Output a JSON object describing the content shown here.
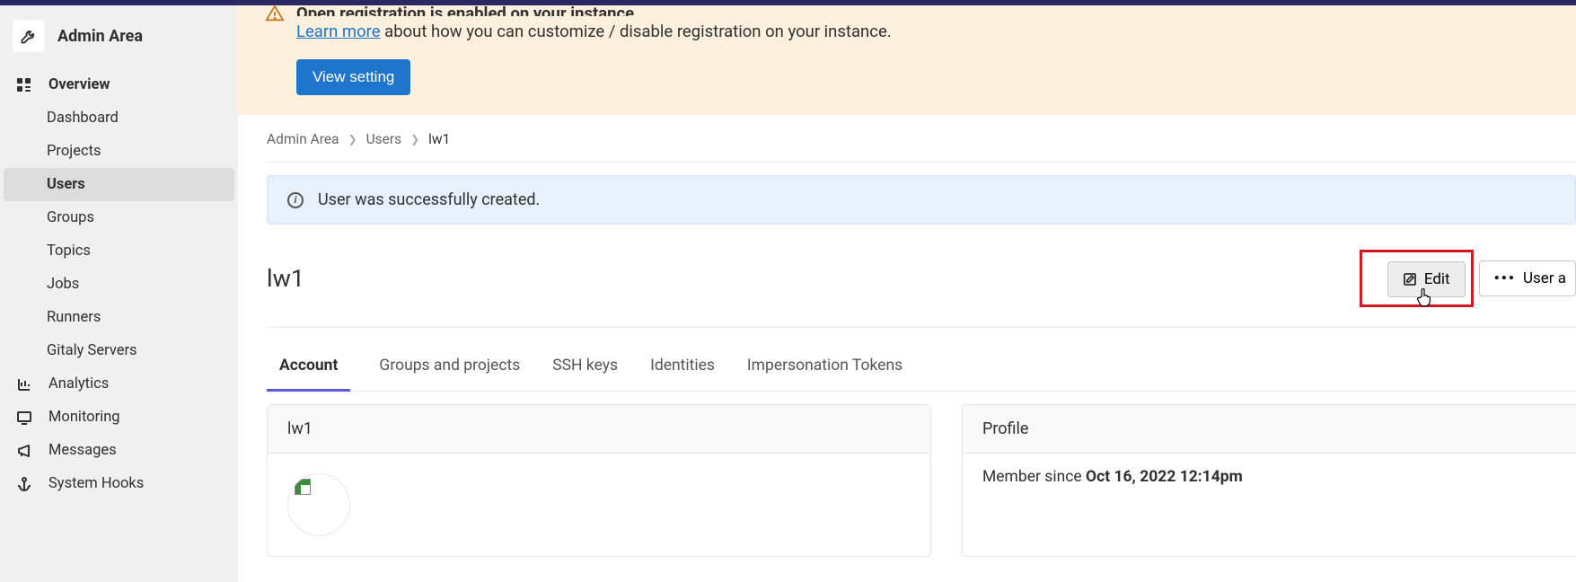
{
  "sidebar": {
    "title": "Admin Area",
    "overview": "Overview",
    "items": {
      "dashboard": "Dashboard",
      "projects": "Projects",
      "users": "Users",
      "groups": "Groups",
      "topics": "Topics",
      "jobs": "Jobs",
      "runners": "Runners",
      "gitaly": "Gitaly Servers"
    },
    "analytics": "Analytics",
    "monitoring": "Monitoring",
    "messages": "Messages",
    "system_hooks": "System Hooks"
  },
  "alert": {
    "heading": "Open registration is enabled on your instance.",
    "learn_more": "Learn more",
    "body_rest": " about how you can customize / disable registration on your instance.",
    "view_setting": "View setting"
  },
  "breadcrumbs": {
    "a": "Admin Area",
    "b": "Users",
    "c": "lw1"
  },
  "flash": "User was successfully created.",
  "user": {
    "name": "lw1",
    "edit": "Edit",
    "user_actions": "User a"
  },
  "tabs": {
    "account": "Account",
    "groups": "Groups and projects",
    "ssh": "SSH keys",
    "identities": "Identities",
    "tokens": "Impersonation Tokens"
  },
  "cards": {
    "left_header": "lw1",
    "right_header": "Profile",
    "member_since_label": "Member since ",
    "member_since_value": "Oct 16, 2022 12:14pm"
  }
}
